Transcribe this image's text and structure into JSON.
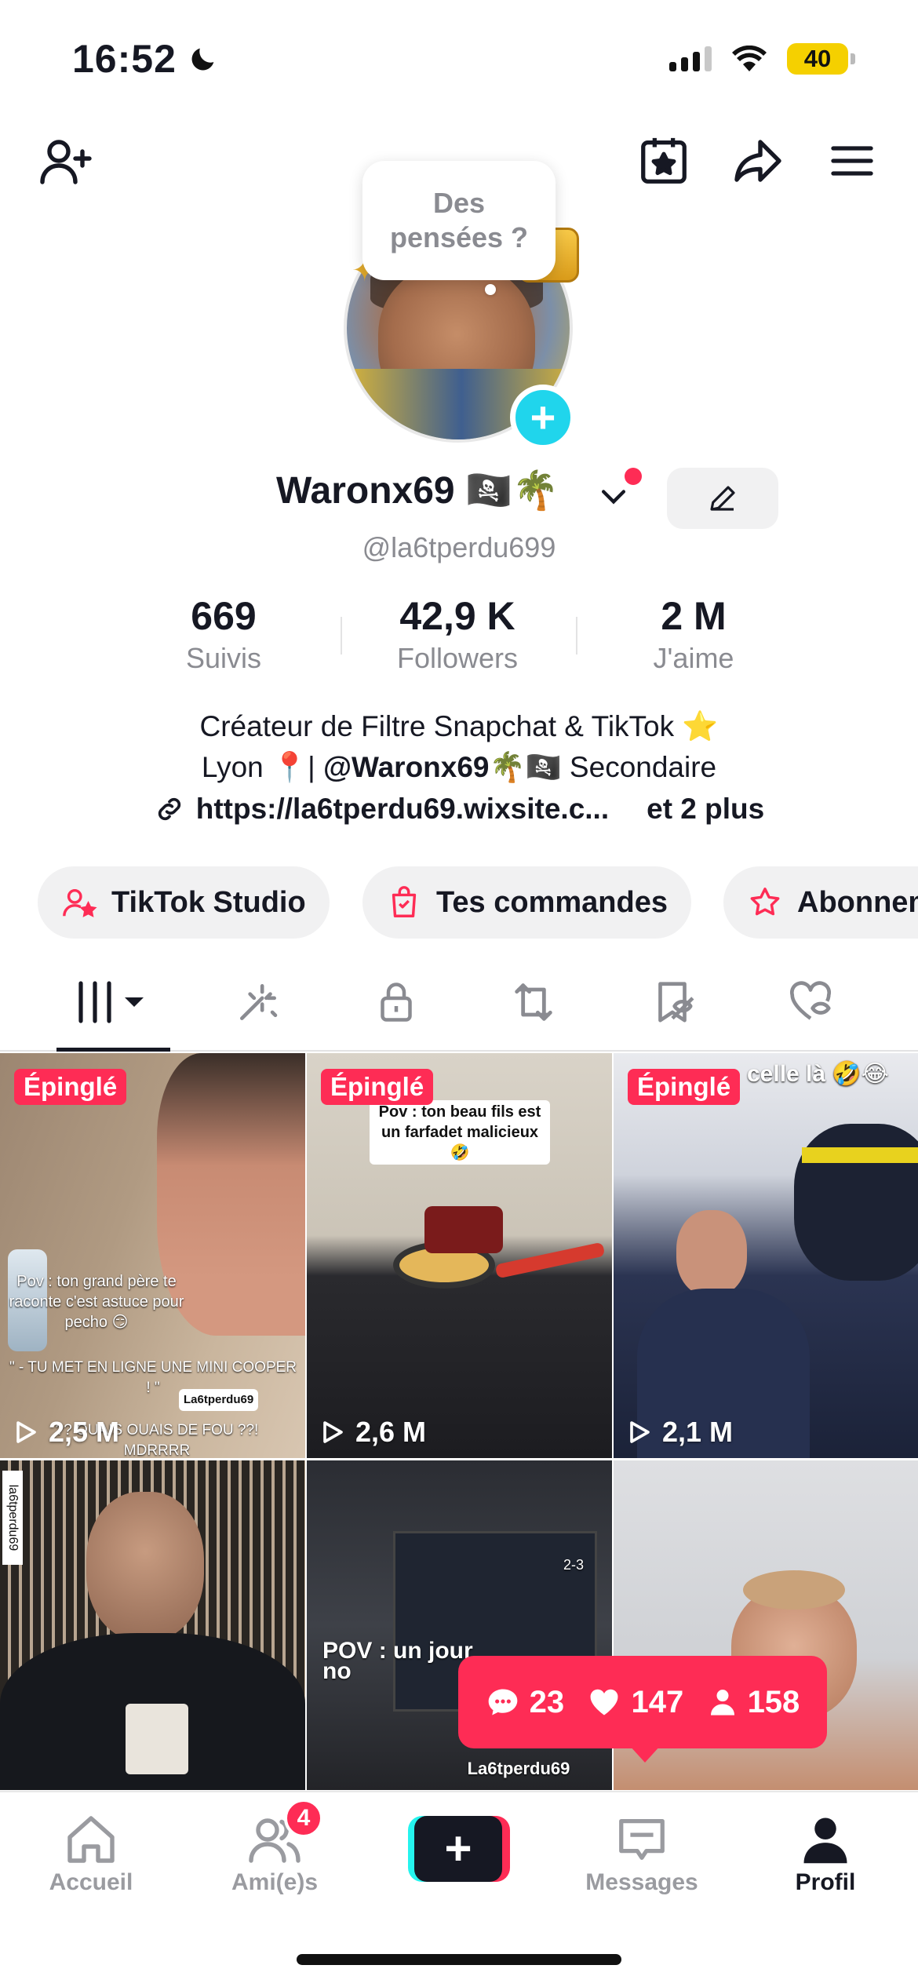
{
  "status_bar": {
    "time": "16:52",
    "battery": "40"
  },
  "profile": {
    "thought_bubble": "Des pensées ?",
    "display_name": "Waronx69 🏴‍☠️🌴",
    "handle": "@la6tperdu699",
    "stats": [
      {
        "value": "669",
        "label": "Suivis"
      },
      {
        "value": "42,9 K",
        "label": "Followers"
      },
      {
        "value": "2 M",
        "label": "J'aime"
      }
    ],
    "bio_line1": "Créateur de Filtre Snapchat & TikTok ⭐",
    "bio_line2_pre": "Lyon 📍| ",
    "bio_line2_mention": "@Waronx69🌴🏴‍☠️",
    "bio_line2_post": " Secondaire",
    "link": "https://la6tperdu69.wixsite.c...",
    "link_more": "et 2 plus"
  },
  "chips": [
    {
      "label": "TikTok Studio",
      "icon": "studio-icon"
    },
    {
      "label": "Tes commandes",
      "icon": "orders-icon"
    },
    {
      "label": "Abonnem",
      "icon": "subscription-icon"
    }
  ],
  "tabs": [
    {
      "name": "videos",
      "icon": "grid-icon"
    },
    {
      "name": "effects",
      "icon": "effects-icon"
    },
    {
      "name": "private",
      "icon": "lock-icon"
    },
    {
      "name": "reposts",
      "icon": "repost-icon"
    },
    {
      "name": "favorites",
      "icon": "bookmark-hidden-icon"
    },
    {
      "name": "liked",
      "icon": "heart-hidden-icon"
    }
  ],
  "videos": [
    {
      "pinned": "Épinglé",
      "views": "2,5 M",
      "caption": "Pov : ton grand père te raconte c'est astuce pour pecho 😏",
      "caption2": "\" - TU MET EN LIGNE UNE MINI COOPER ! \"",
      "caption3": "?? OUAIS OUAIS DE FOU ??! MDRRRR",
      "watermark": "La6tperdu69"
    },
    {
      "pinned": "Épinglé",
      "views": "2,6 M",
      "caption": "Pov : ton beau fils est un farfadet malicieux 🤣"
    },
    {
      "pinned": "Épinglé",
      "views": "2,1 M",
      "caption": "celle là 🤣😂"
    },
    {
      "watermark": "la6tperdu69"
    },
    {
      "caption": "POV : un jour no",
      "watermark": "La6tperdu69",
      "screen_text": "2-3"
    },
    {}
  ],
  "notification": {
    "comments": "23",
    "likes": "147",
    "followers": "158"
  },
  "bottom_nav": [
    {
      "label": "Accueil"
    },
    {
      "label": "Ami(e)s",
      "badge": "4"
    },
    {
      "label": ""
    },
    {
      "label": "Messages"
    },
    {
      "label": "Profil"
    }
  ]
}
